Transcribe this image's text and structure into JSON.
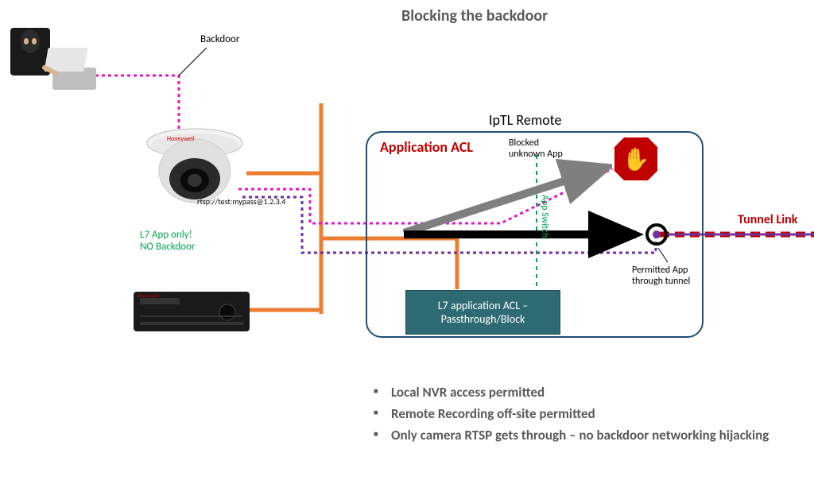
{
  "title": "Blocking the backdoor",
  "labels": {
    "backdoor": "Backdoor",
    "rtsp": "rtsp://test:mypass@1.2.3.4",
    "l7only_line1": "L7 App only!",
    "l7only_line2": "NO Backdoor",
    "application_acl": "Application ACL",
    "iptl_remote": "IpTL Remote",
    "blocked_unknown": "Blocked unknown App",
    "app_switch": "App Switch",
    "permitted_app": "Permitted App through tunnel",
    "l7_box_line1": "L7 application ACL –",
    "l7_box_line2": "Passthrough/Block",
    "tunnel_link": "Tunnel Link"
  },
  "bullets": [
    "Local NVR access permitted",
    "Remote Recording off-site permitted",
    "Only camera RTSP gets through – no backdoor networking hijacking"
  ],
  "colors": {
    "orange": "#ed7d31",
    "magenta": "#e815c6",
    "purple": "#7030a0",
    "darkblue": "#1f4e79",
    "red": "#c00000",
    "teal": "#2e6a74",
    "green": "#00a650"
  }
}
